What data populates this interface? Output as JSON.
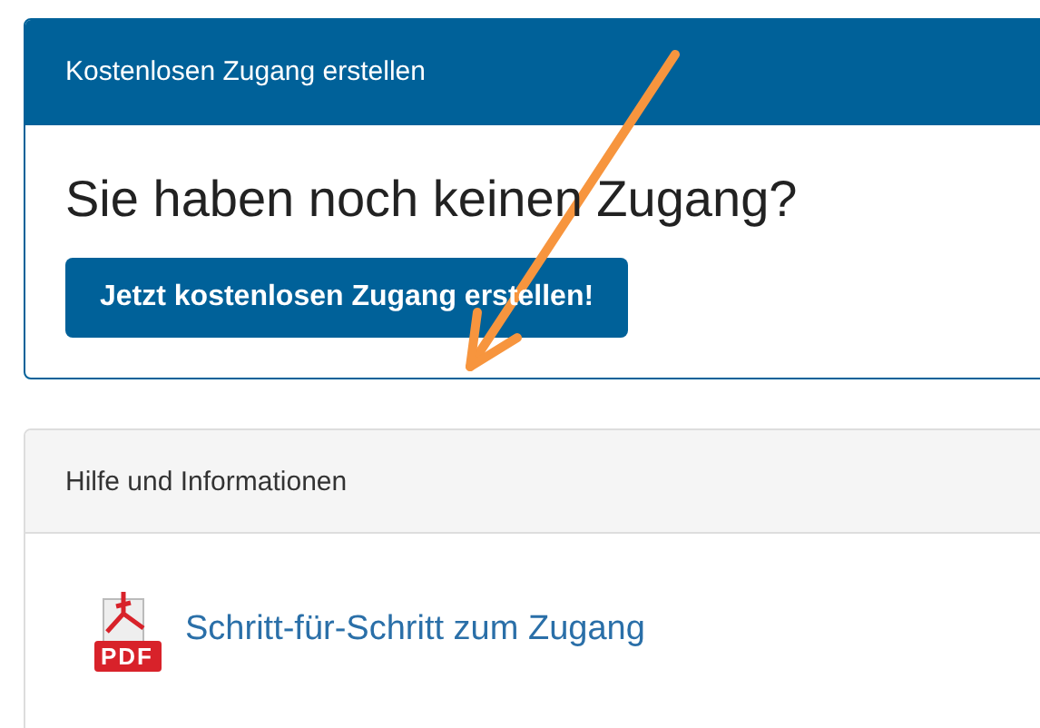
{
  "signup_panel": {
    "heading": "Kostenlosen Zugang erstellen",
    "question": "Sie haben noch keinen Zugang?",
    "button": "Jetzt kostenlosen Zugang erstellen!"
  },
  "help_panel": {
    "heading": "Hilfe und Informationen",
    "links": [
      {
        "icon_label": "PDF",
        "label": "Schritt-für-Schritt zum Zugang"
      }
    ]
  }
}
